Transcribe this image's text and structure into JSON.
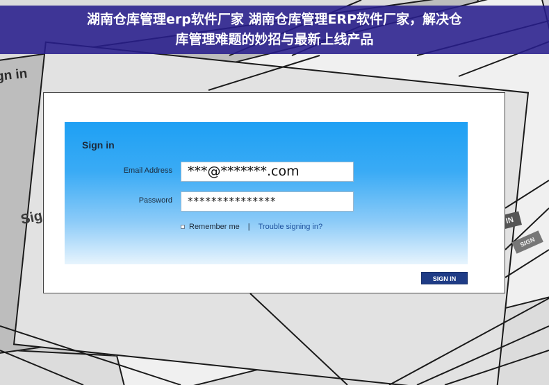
{
  "banner": {
    "line1": "湖南仓库管理erp软件厂家 湖南仓库管理ERP软件厂家，解决仓",
    "line2": "库管理难题的妙招与最新上线产品"
  },
  "background": {
    "text_top_left": "gn in",
    "text_left": "Sig",
    "pill_right": "IN",
    "pill_right_small": "SIGN"
  },
  "form": {
    "title": "Sign in",
    "email_label": "Email Address",
    "email_value": "***@*******.com",
    "password_label": "Password",
    "password_value": "***************",
    "remember_label": "Remember me",
    "separator": "|",
    "trouble_link": "Trouble signing in?",
    "submit_label": "SIGN IN"
  },
  "colors": {
    "banner": "#281e8c",
    "panel_top": "#1ea0f4",
    "button": "#1f3c86"
  }
}
